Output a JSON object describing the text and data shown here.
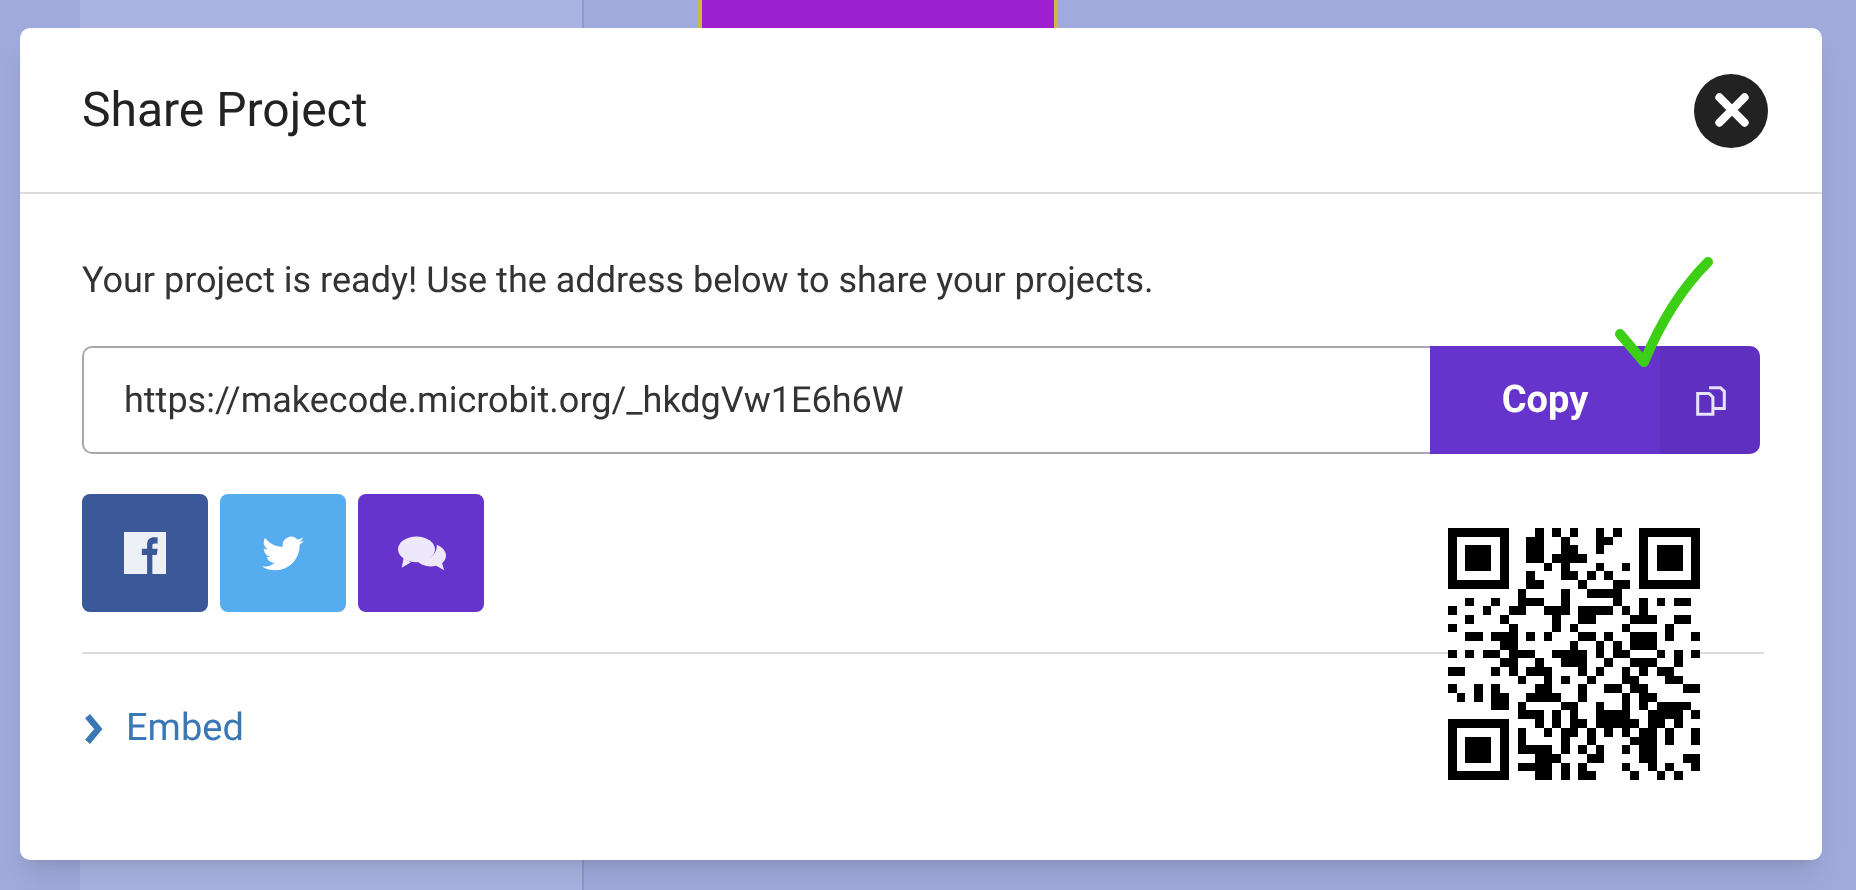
{
  "dialog": {
    "title": "Share Project",
    "message": "Your project is ready! Use the address below to share your projects.",
    "url": "https://makecode.microbit.org/_hkdgVw1E6h6W",
    "copy_button": "Copy",
    "share_buttons": [
      {
        "kind": "facebook"
      },
      {
        "kind": "twitter"
      },
      {
        "kind": "chat"
      }
    ],
    "embed": {
      "label": "Embed",
      "expanded": false
    }
  }
}
